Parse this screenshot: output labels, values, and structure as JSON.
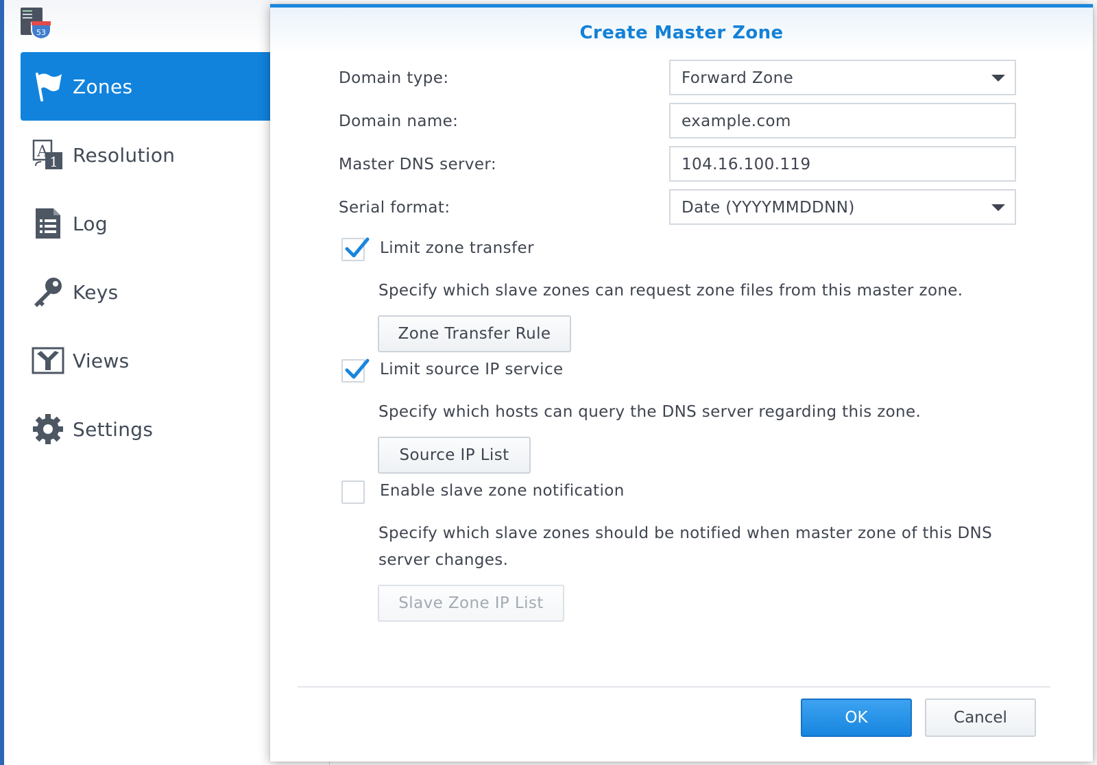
{
  "app": {
    "icon_badge": "53"
  },
  "sidebar": {
    "items": [
      {
        "label": "Zones",
        "icon": "flag-icon",
        "active": true
      },
      {
        "label": "Resolution",
        "icon": "resolution-icon",
        "active": false
      },
      {
        "label": "Log",
        "icon": "log-icon",
        "active": false
      },
      {
        "label": "Keys",
        "icon": "key-icon",
        "active": false
      },
      {
        "label": "Views",
        "icon": "views-icon",
        "active": false
      },
      {
        "label": "Settings",
        "icon": "gear-icon",
        "active": false
      }
    ]
  },
  "dialog": {
    "title": "Create Master Zone",
    "fields": {
      "domain_type": {
        "label": "Domain type:",
        "value": "Forward Zone"
      },
      "domain_name": {
        "label": "Domain name:",
        "value": "example.com"
      },
      "master_dns": {
        "label": "Master DNS server:",
        "value": "104.16.100.119"
      },
      "serial_format": {
        "label": "Serial format:",
        "value": "Date (YYYYMMDDNN)"
      }
    },
    "options": {
      "limit_zone_transfer": {
        "label": "Limit zone transfer",
        "checked": true,
        "description": "Specify which slave zones can request zone files from this master zone.",
        "button": "Zone Transfer Rule"
      },
      "limit_source_ip": {
        "label": "Limit source IP service",
        "checked": true,
        "description": "Specify which hosts can query the DNS server regarding this zone.",
        "button": "Source IP List"
      },
      "slave_notification": {
        "label": "Enable slave zone notification",
        "checked": false,
        "description": "Specify which slave zones should be notified when master zone of this DNS server changes.",
        "button": "Slave Zone IP List"
      }
    },
    "footer": {
      "ok_label": "OK",
      "cancel_label": "Cancel"
    }
  },
  "colors": {
    "accent": "#1183dd",
    "title": "#1481d6",
    "checkmark": "#1a86dd"
  }
}
